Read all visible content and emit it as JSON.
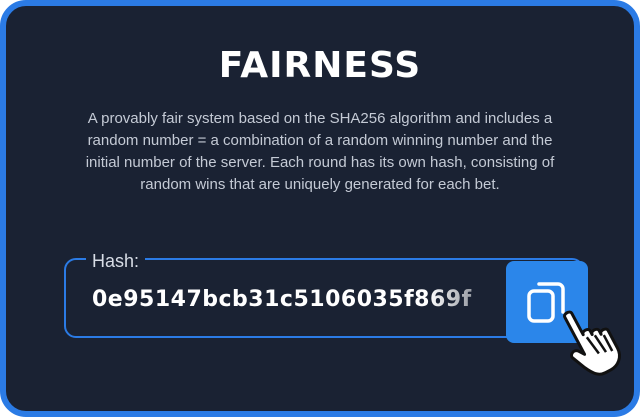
{
  "modal": {
    "title": "FAIRNESS",
    "description": "A provably fair system based on the SHA256 algorithm and includes a random number = a combination of a random winning number and the initial number of the server. Each round has its own hash, consisting of random wins that are uniquely generated for each bet.",
    "hash": {
      "label": "Hash:",
      "value": "0e95147bcb31c5106035f869f",
      "copy_icon": "copy-icon"
    },
    "cursor_icon": "hand-pointer-icon"
  },
  "colors": {
    "background": "#1a2233",
    "accent": "#2b7be5",
    "button": "#2b86ea",
    "text_primary": "#ffffff",
    "text_secondary": "#c4cad5"
  }
}
